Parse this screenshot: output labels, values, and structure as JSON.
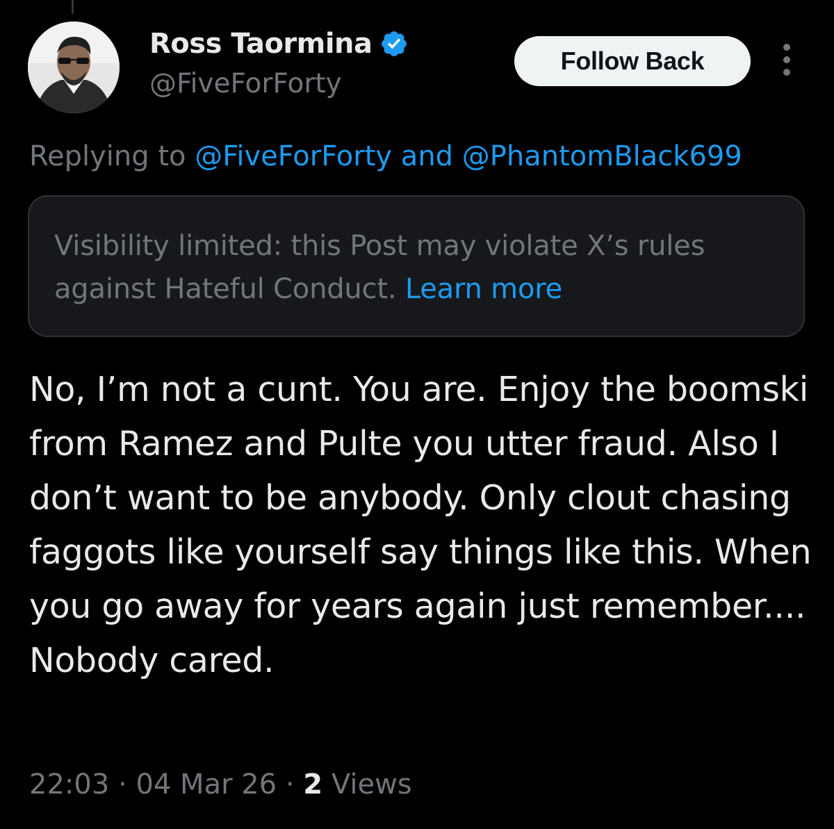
{
  "author": {
    "display_name": "Ross Taormina",
    "handle": "@FiveForForty",
    "verified": true,
    "verified_color": "#1d9bf0"
  },
  "follow_button": {
    "label": "Follow Back"
  },
  "reply_context": {
    "prefix": "Replying to ",
    "mention_1": "@FiveForForty",
    "joiner": " and ",
    "mention_2": "@PhantomBlack699"
  },
  "notice": {
    "text": "Visibility limited: this Post may violate X’s rules against Hateful Conduct. ",
    "link_label": "Learn more"
  },
  "post": {
    "text": "No, I’m not a cunt.   You are.  Enjoy the boomski from Ramez and Pulte you utter fraud.   Also I don’t want to be anybody. Only clout chasing faggots like yourself say things like this.   When you go away for years again just remember.... Nobody cared."
  },
  "meta": {
    "time": "22:03",
    "date": "04 Mar 26",
    "separator": " · ",
    "views_count": "2",
    "views_label": " Views"
  },
  "colors": {
    "background": "#000000",
    "text_primary": "#e7e9ea",
    "text_secondary": "#71767b",
    "accent": "#1d9bf0",
    "notice_bg": "#16181c",
    "border": "#2f3336"
  },
  "icons": {
    "verified": "verified-badge-icon",
    "more": "more-vertical-icon"
  }
}
